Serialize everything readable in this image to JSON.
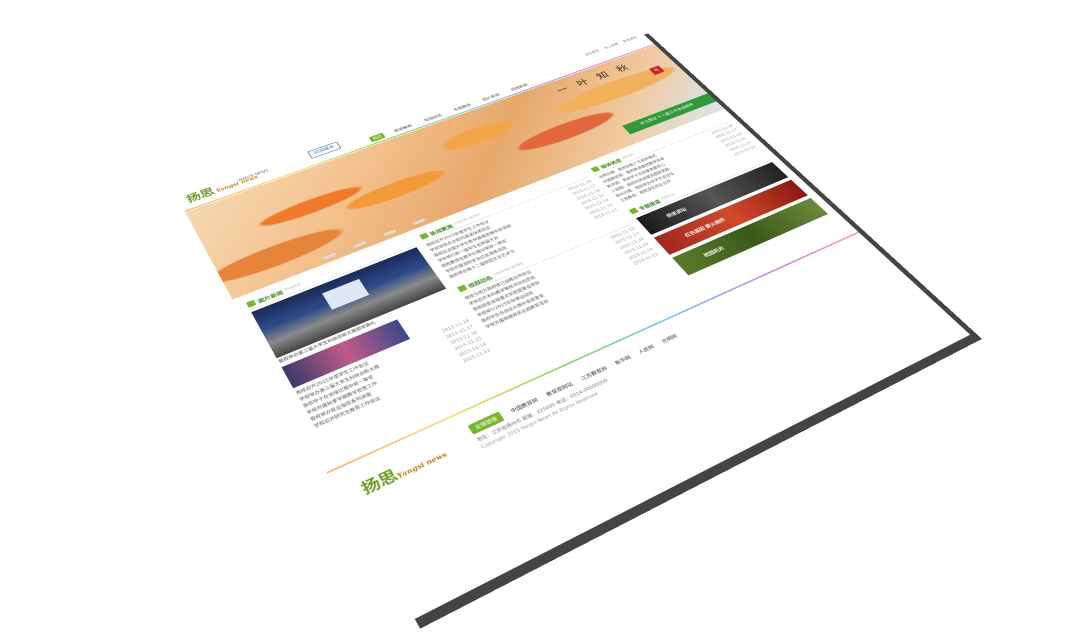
{
  "header": {
    "logo_text": "扬思",
    "logo_sub": "Yangsi news",
    "badge": "校园媒体",
    "slogan": "YANGSI NEWS",
    "nav": [
      "首页",
      "新闻聚焦",
      "校园动态",
      "专题报道",
      "图片新闻",
      "视频新闻"
    ],
    "toplinks": [
      "设为首页",
      "加入收藏",
      "联系我们"
    ]
  },
  "banner": {
    "title": "一叶知秋",
    "stamp": "秋",
    "ribbon": "学习贯彻 十八届五中全会精神"
  },
  "sections": {
    "photo": {
      "title": "图片新闻",
      "en": "PHOTO",
      "caption": "我校举办第三届大学生科技创新大赛颁奖典礼"
    },
    "focus": {
      "title": "新闻聚焦",
      "en": "FOCUS NEWS",
      "items": [
        {
          "t": "我校召开2015年度学生工作会议",
          "d": "2015-11-18"
        },
        {
          "t": "学校领导走访慰问离退休老同志",
          "d": "2015-11-17"
        },
        {
          "t": "我校在全国大学生数学建模竞赛中获佳绩",
          "d": "2015-11-16"
        },
        {
          "t": "学校举行新一届学生会换届大会",
          "d": "2015-11-15"
        },
        {
          "t": "我校教师在教学比赛中荣获一等奖",
          "d": "2015-11-14"
        },
        {
          "t": "学校开展消防安全应急演练活动",
          "d": "2015-11-13"
        },
        {
          "t": "我校举办第十二届校园文化艺术节",
          "d": "2015-11-12"
        }
      ]
    },
    "campus": {
      "title": "校园动态",
      "en": "CAMPUS NEWS",
      "items": [
        {
          "t": "我校与地方政府签订战略合作协议",
          "d": "2015-11-18"
        },
        {
          "t": "学校召开本科教学审核评估动员会",
          "d": "2015-11-17"
        },
        {
          "t": "我校获批省级重点实验室建设项目",
          "d": "2015-11-16"
        },
        {
          "t": "学校举行2015年秋季运动会",
          "d": "2015-11-15"
        },
        {
          "t": "我校学生在创业大赛中喜获金奖",
          "d": "2015-11-14"
        },
        {
          "t": "学校开展师德师风主题教育活动",
          "d": "2015-11-13"
        }
      ]
    },
    "media": {
      "title": "媒体扬思",
      "en": "MEDIA",
      "items": [
        {
          "t": "光明日报：我校创新人才培养模式",
          "d": "2015-11-18"
        },
        {
          "t": "中国教育报：我校推进教育教学改革",
          "d": "2015-11-17"
        },
        {
          "t": "新华网：我校学子志愿服务献爱心",
          "d": "2015-11-16"
        },
        {
          "t": "人民网：我校科研成果获国家奖励",
          "d": "2015-11-15"
        },
        {
          "t": "扬州日报：我校举办学术交流论坛",
          "d": "2015-11-14"
        },
        {
          "t": "江苏教育：我校深化校企合作",
          "d": "2015-11-13"
        }
      ]
    },
    "topics": {
      "title": "专题报道",
      "en": "TOPICS",
      "promos": [
        "扬思讲坛",
        "红色基因 薪火相传",
        "校园风光"
      ]
    },
    "left_list": {
      "items": [
        {
          "t": "我校召开2015年度学生工作会议",
          "d": "2015-11-18"
        },
        {
          "t": "学校举办第三届大学生科技创新大赛",
          "d": "2015-11-17"
        },
        {
          "t": "我校学子在省级比赛中获一等奖",
          "d": "2015-11-16"
        },
        {
          "t": "学校开展秋季学期教学检查工作",
          "d": "2015-11-15"
        },
        {
          "t": "我校举办就业指导系列讲座",
          "d": "2015-11-14"
        },
        {
          "t": "学校召开研究生教育工作会议",
          "d": "2015-11-13"
        }
      ]
    }
  },
  "footer": {
    "logo_text": "扬思",
    "logo_sub": "Yangsi news",
    "tag": "友情链接",
    "links": [
      "中国教育网",
      "教育部网站",
      "江苏教育网",
      "新华网",
      "人民网",
      "光明网"
    ],
    "address": "地址：江苏省扬州市 邮编：225000 电话：0514-00000000",
    "copyright": "Copyright 2015 Yangsi News All Rights Reserved"
  },
  "colors": {
    "accent": "#76b82a",
    "brand_text": "#6a9b1f",
    "ribbon": "#2f9a3a"
  }
}
